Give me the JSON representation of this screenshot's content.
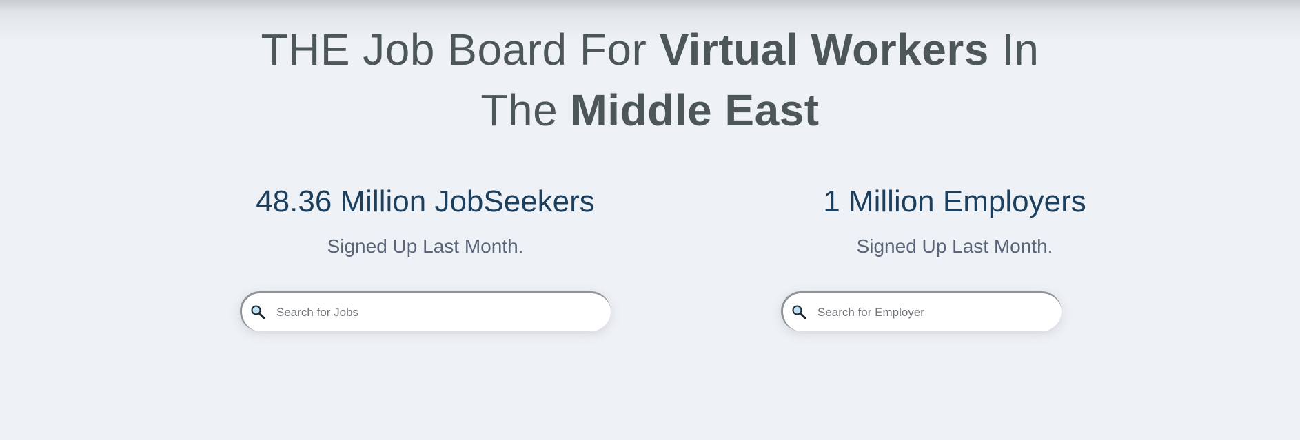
{
  "headline": {
    "line1_prefix": "THE Job Board For ",
    "line1_bold": "Virtual Workers",
    "line1_suffix": " In",
    "line2_prefix": "The ",
    "line2_bold": "Middle East"
  },
  "stats": {
    "jobseekers": {
      "value": "48.36 Million JobSeekers",
      "subtitle": "Signed Up Last Month."
    },
    "employers": {
      "value": "1 Million Employers",
      "subtitle": "Signed Up Last Month."
    }
  },
  "search": {
    "jobs_placeholder": "Search for Jobs",
    "employer_placeholder": "Search for Employer",
    "icon": "magnifier-icon"
  },
  "colors": {
    "background": "#eef1f5",
    "headline": "#4d5658",
    "stat_value": "#1c3f5e",
    "stat_subtitle": "#5a6478"
  }
}
